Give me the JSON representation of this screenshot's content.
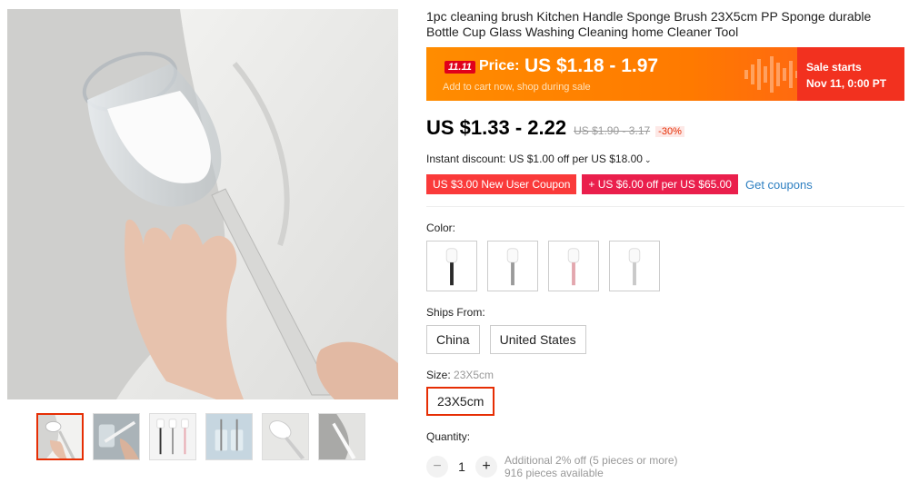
{
  "product": {
    "title": "1pc cleaning brush Kitchen Handle Sponge Brush 23X5cm PP Sponge durable Bottle Cup Glass Washing Cleaning home Cleaner Tool"
  },
  "sale_banner": {
    "badge": "11.11",
    "price_label": "Price:",
    "price_range": "US $1.18 - 1.97",
    "subtext": "Add to cart now, shop during sale",
    "starts_label": "Sale starts",
    "starts_date": "Nov 11, 0:00 PT",
    "accent_color": "#ff7a00",
    "right_color": "#f2311f"
  },
  "pricing": {
    "current": "US $1.33 - 2.22",
    "original": "US $1.90 - 3.17",
    "discount": "-30%"
  },
  "instant_discount": {
    "text": "Instant discount: US $1.00 off per US $18.00",
    "caret_icon": "chevron-down-icon"
  },
  "coupons": {
    "items": [
      {
        "label": "US $3.00 New User Coupon"
      },
      {
        "label": "+ US $6.00 off per US $65.00"
      }
    ],
    "get_label": "Get coupons"
  },
  "color": {
    "label": "Color:",
    "swatches": [
      "black",
      "gray",
      "pink",
      "light-gray"
    ]
  },
  "ships_from": {
    "label": "Ships From:",
    "options": [
      "China",
      "United States"
    ]
  },
  "size": {
    "label": "Size:",
    "selected_value": "23X5cm",
    "options": [
      "23X5cm"
    ]
  },
  "quantity": {
    "label": "Quantity:",
    "value": "1",
    "minus": "−",
    "plus": "+",
    "note": "Additional 2% off (5 pieces or more)",
    "available": "916 pieces available"
  },
  "gallery": {
    "thumbnail_count": 6,
    "active_index": 0
  }
}
